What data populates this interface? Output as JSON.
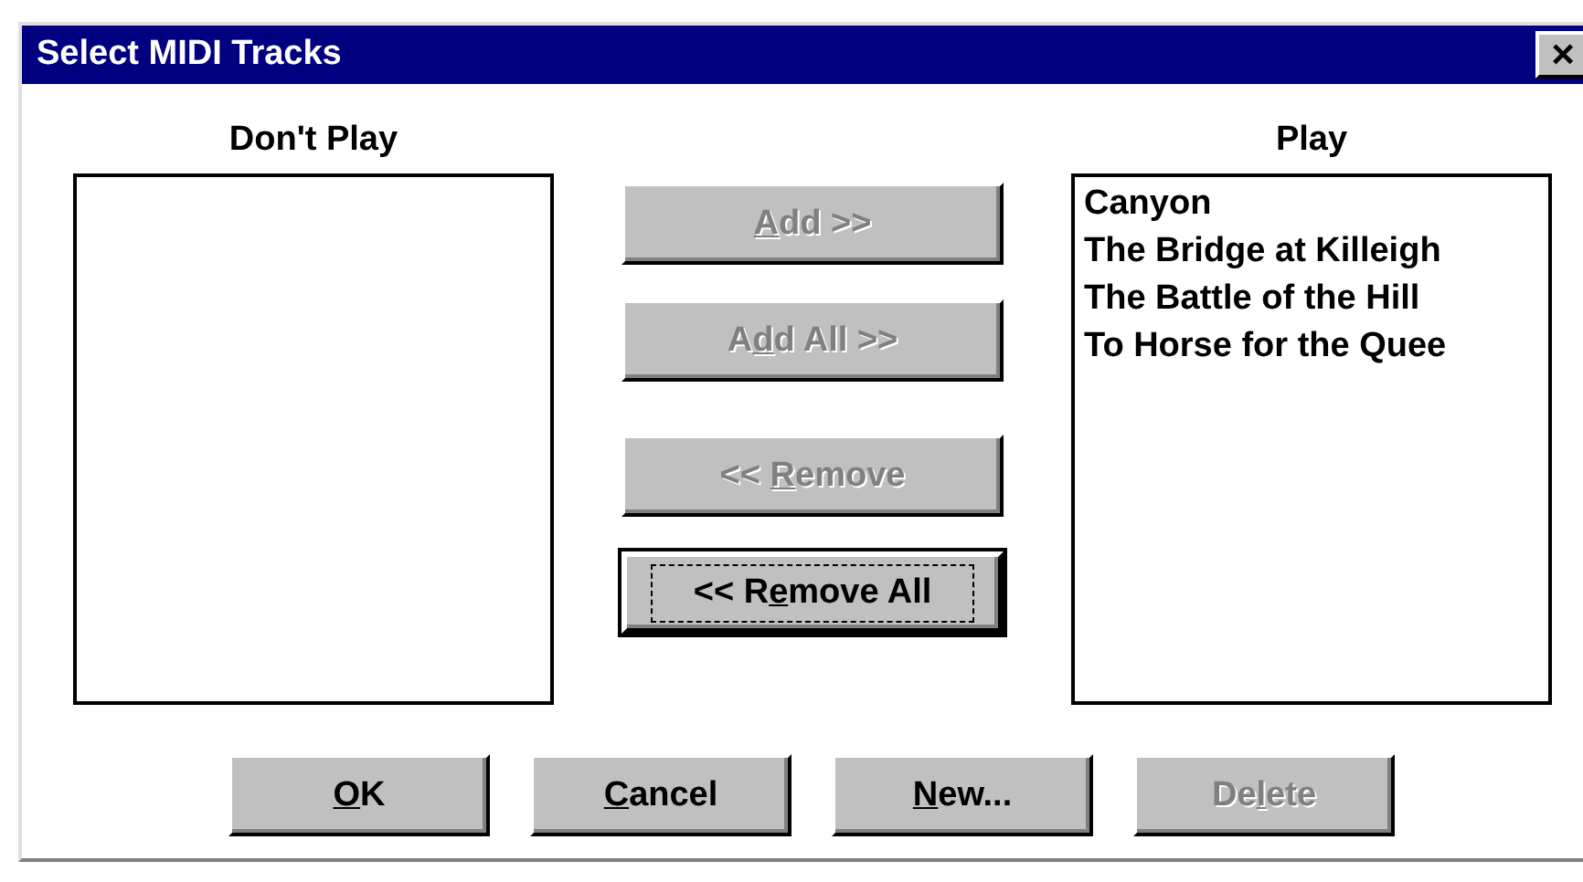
{
  "window": {
    "title": "Select MIDI Tracks",
    "close": "×"
  },
  "dont_play": {
    "label": "Don't Play"
  },
  "move_buttons": [
    {
      "key": "A",
      "after": "dd >>",
      "disabled": true,
      "default": false
    },
    {
      "before": "A",
      "key": "d",
      "after": "d All >>",
      "disabled": true,
      "default": false
    },
    {
      "before": "<< ",
      "key": "R",
      "after": "emove",
      "disabled": true,
      "default": false
    },
    {
      "before": "<< R",
      "key": "e",
      "after": "move All",
      "disabled": false,
      "default": true
    }
  ],
  "play": {
    "label": "Play",
    "items": [
      "Canyon",
      "The Bridge at Killeigh",
      "The Battle of the Hill",
      "To Horse for the Quee"
    ]
  },
  "buttons": [
    {
      "key": "O",
      "after": "K",
      "disabled": false
    },
    {
      "key": "C",
      "after": "ancel",
      "disabled": false
    },
    {
      "key": "N",
      "after": "ew...",
      "disabled": false
    },
    {
      "before": "De",
      "key": "l",
      "after": "ete",
      "disabled": true
    }
  ]
}
